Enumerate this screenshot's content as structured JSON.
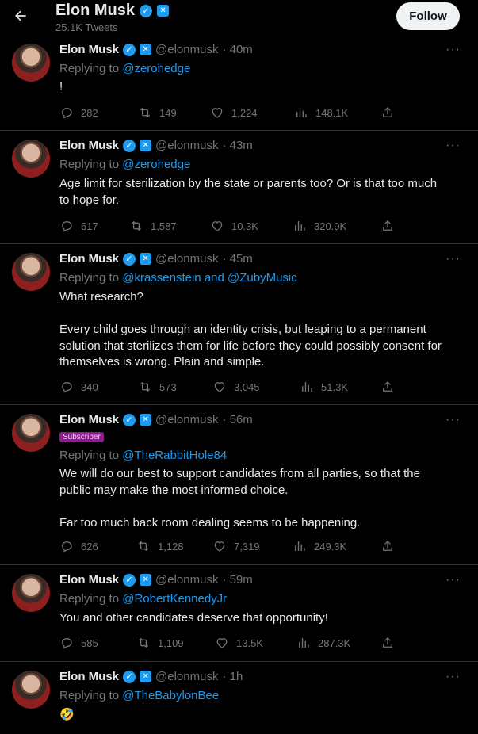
{
  "header": {
    "title": "Elon Musk",
    "subtitle": "25.1K Tweets",
    "follow_label": "Follow",
    "back_icon": "arrow-left-icon"
  },
  "colors": {
    "background": "#000000",
    "link": "#1d9bf0",
    "muted": "#71767b",
    "text": "#e7e9ea",
    "subscriber_badge": "#8e1b8f"
  },
  "tweets": [
    {
      "name": "Elon Musk",
      "handle": "@elonmusk",
      "time": "· 40m",
      "replying_label": "Replying to",
      "replying_to": "@zerohedge",
      "text": "!",
      "replies": "282",
      "retweets": "149",
      "likes": "1,224",
      "views": "148.1K"
    },
    {
      "name": "Elon Musk",
      "handle": "@elonmusk",
      "time": "· 43m",
      "replying_label": "Replying to",
      "replying_to": "@zerohedge",
      "text": "Age limit for sterilization by the state or parents too? Or is that too much\nto hope for.",
      "replies": "617",
      "retweets": "1,587",
      "likes": "10.3K",
      "views": "320.9K"
    },
    {
      "name": "Elon Musk",
      "handle": "@elonmusk",
      "time": "· 45m",
      "replying_label": "Replying to",
      "replying_to": "@krassenstein and @ZubyMusic",
      "text": "What research?\n\nEvery child goes through an identity crisis, but leaping to a permanent\nsolution that sterilizes them for life before they could possibly consent for\nthemselves is wrong. Plain and simple.",
      "replies": "340",
      "retweets": "573",
      "likes": "3,045",
      "views": "51.3K"
    },
    {
      "name": "Elon Musk",
      "handle": "@elonmusk",
      "time": "· 56m",
      "subscriber": "Subscriber",
      "replying_label": "Replying to",
      "replying_to": "@TheRabbitHole84",
      "text": "We will do our best to support candidates from all parties, so that the\npublic may make the most informed choice.\n\nFar too much back room dealing seems to be happening.",
      "replies": "626",
      "retweets": "1,128",
      "likes": "7,319",
      "views": "249.3K"
    },
    {
      "name": "Elon Musk",
      "handle": "@elonmusk",
      "time": "· 59m",
      "replying_label": "Replying to",
      "replying_to": "@RobertKennedyJr",
      "text": "You and other candidates deserve that opportunity!",
      "replies": "585",
      "retweets": "1,109",
      "likes": "13.5K",
      "views": "287.3K"
    },
    {
      "name": "Elon Musk",
      "handle": "@elonmusk",
      "time": "· 1h",
      "replying_label": "Replying to",
      "replying_to": "@TheBabylonBee",
      "text": "🤣"
    }
  ],
  "icons": {
    "reply": "reply-icon",
    "retweet": "retweet-icon",
    "like": "heart-icon",
    "views": "views-icon",
    "share": "share-icon",
    "more": "more-icon",
    "verified": "verified-badge-icon",
    "affiliate": "x-affiliate-icon"
  }
}
